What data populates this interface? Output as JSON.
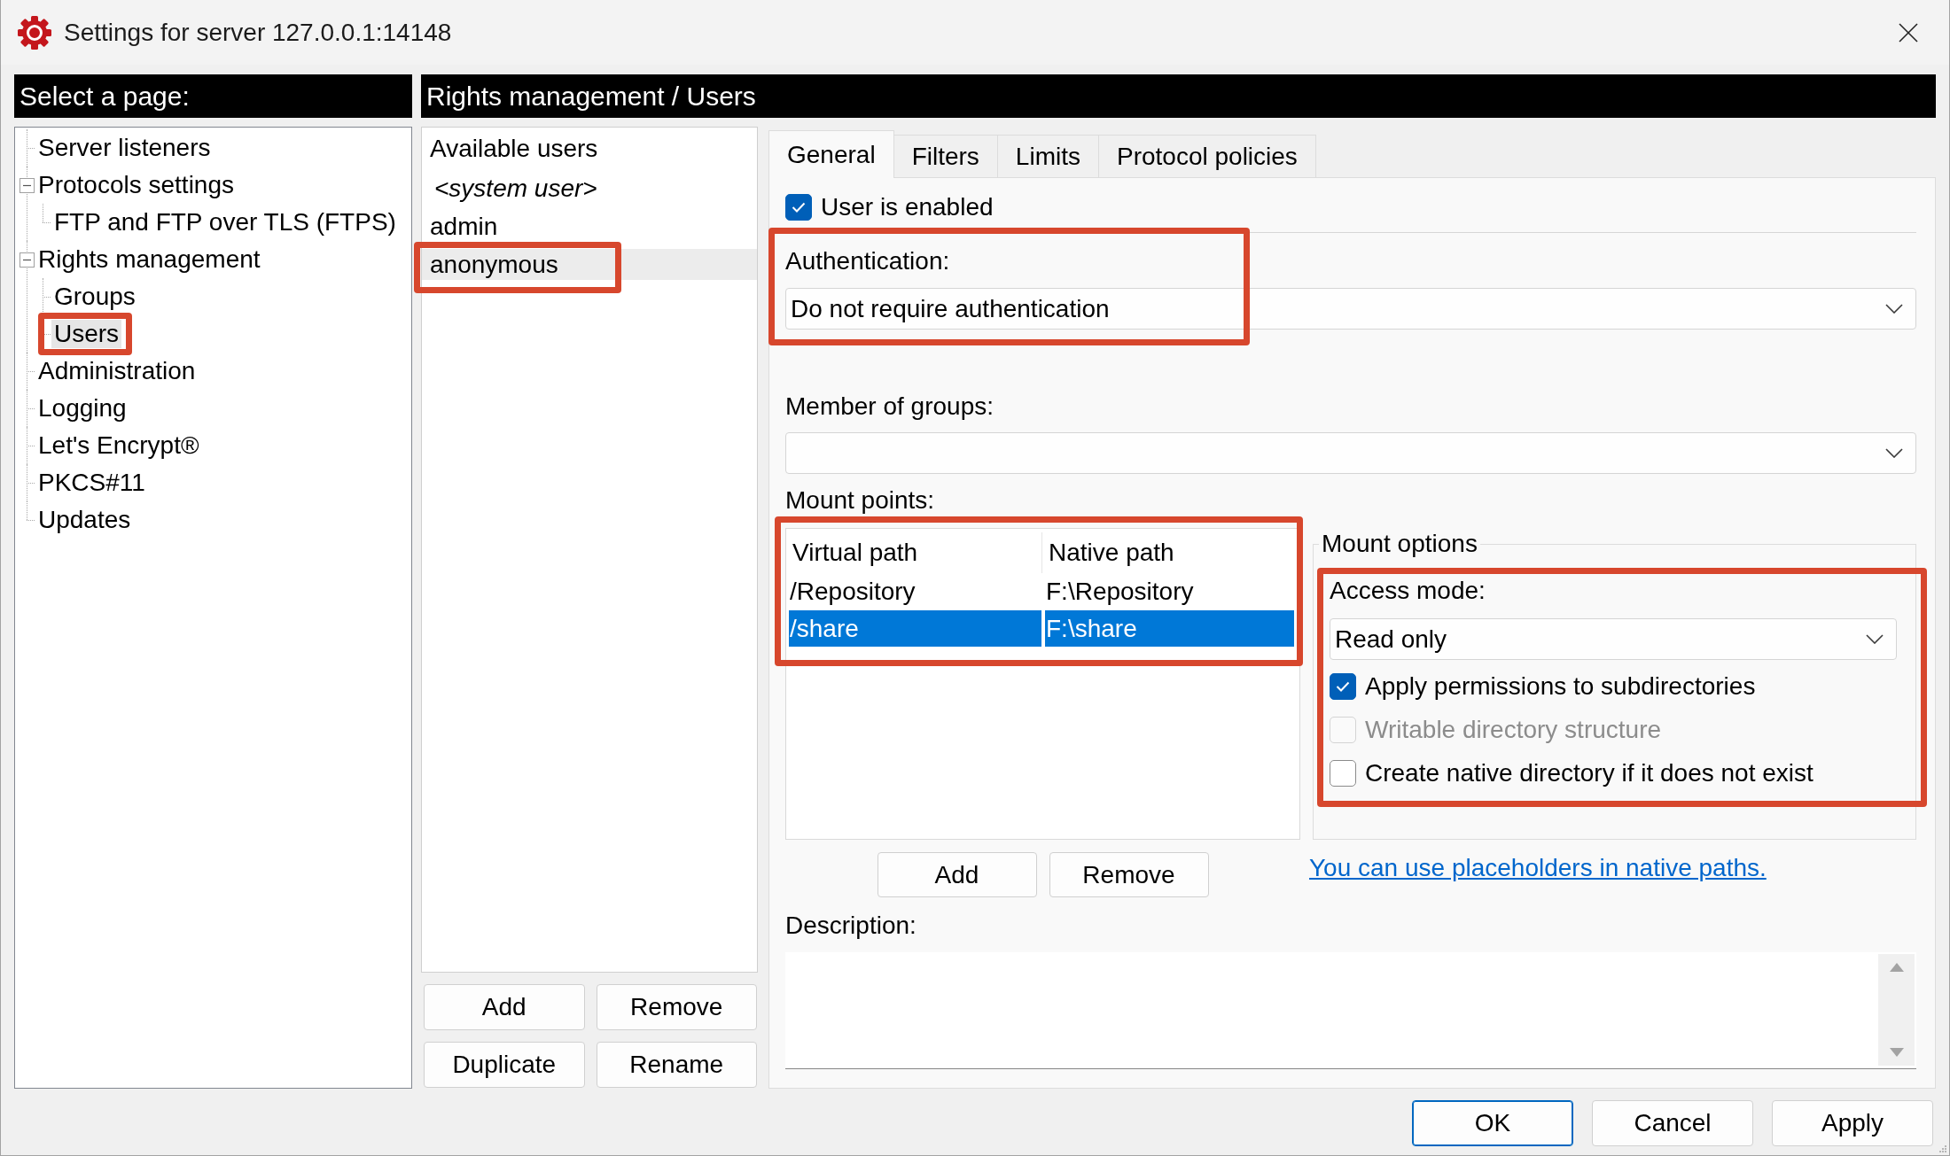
{
  "window": {
    "title": "Settings for server 127.0.0.1:14148"
  },
  "page_list": {
    "header": "Select a page:",
    "tree": [
      {
        "label": "Server listeners",
        "selected": false,
        "highlighted": false
      },
      {
        "label": "Protocols settings",
        "selected": false,
        "highlighted": false,
        "expanded": true,
        "children": [
          {
            "label": "FTP and FTP over TLS (FTPS)",
            "selected": false,
            "highlighted": false
          }
        ]
      },
      {
        "label": "Rights management",
        "selected": false,
        "highlighted": false,
        "expanded": true,
        "children": [
          {
            "label": "Groups",
            "selected": false,
            "highlighted": false
          },
          {
            "label": "Users",
            "selected": true,
            "highlighted": true
          }
        ]
      },
      {
        "label": "Administration",
        "selected": false,
        "highlighted": false
      },
      {
        "label": "Logging",
        "selected": false,
        "highlighted": false
      },
      {
        "label": "Let's Encrypt®",
        "selected": false,
        "highlighted": false
      },
      {
        "label": "PKCS#11",
        "selected": false,
        "highlighted": false
      },
      {
        "label": "Updates",
        "selected": false,
        "highlighted": false
      }
    ]
  },
  "page": {
    "header": "Rights management / Users",
    "users": {
      "heading": "Available users",
      "items": [
        {
          "name": "<system user>",
          "kind": "system",
          "selected": false,
          "highlighted": false
        },
        {
          "name": "admin",
          "kind": "user",
          "selected": false,
          "highlighted": false
        },
        {
          "name": "anonymous",
          "kind": "user",
          "selected": true,
          "highlighted": true
        }
      ],
      "buttons": [
        "Add",
        "Remove",
        "Duplicate",
        "Rename"
      ]
    },
    "tabs": [
      {
        "label": "General",
        "selected": true
      },
      {
        "label": "Filters",
        "selected": false
      },
      {
        "label": "Limits",
        "selected": false
      },
      {
        "label": "Protocol policies",
        "selected": false
      }
    ],
    "general": {
      "user_enabled": {
        "label": "User is enabled",
        "checked": true,
        "disabled": false
      },
      "authentication": {
        "label": "Authentication:",
        "value": "Do not require authentication",
        "highlighted": true
      },
      "member_of_groups": {
        "label": "Member of groups:"
      },
      "mount_points": {
        "label": "Mount points:",
        "highlighted": true,
        "columns": [
          "Virtual path",
          "Native path"
        ],
        "rows": [
          {
            "cells": [
              "/Repository",
              "F:\\Repository"
            ],
            "selected": false
          },
          {
            "cells": [
              "/share",
              "F:\\share"
            ],
            "selected": true
          }
        ],
        "buttons": [
          "Add",
          "Remove"
        ]
      },
      "mount_options": {
        "title": "Mount options",
        "highlighted": true,
        "access_mode": {
          "label": "Access mode:",
          "value": "Read only"
        },
        "options": [
          {
            "label": "Apply permissions to subdirectories",
            "checked": true,
            "disabled": false
          },
          {
            "label": "Writable directory structure",
            "checked": false,
            "disabled": true
          },
          {
            "label": "Create native directory if it does not exist",
            "checked": false,
            "disabled": false
          }
        ]
      },
      "placeholder_link": "You can use placeholders in native paths.",
      "description": {
        "label": "Description:"
      }
    }
  },
  "dialog_buttons": [
    {
      "label": "OK",
      "default": true
    },
    {
      "label": "Cancel",
      "default": false
    },
    {
      "label": "Apply",
      "default": false
    }
  ]
}
